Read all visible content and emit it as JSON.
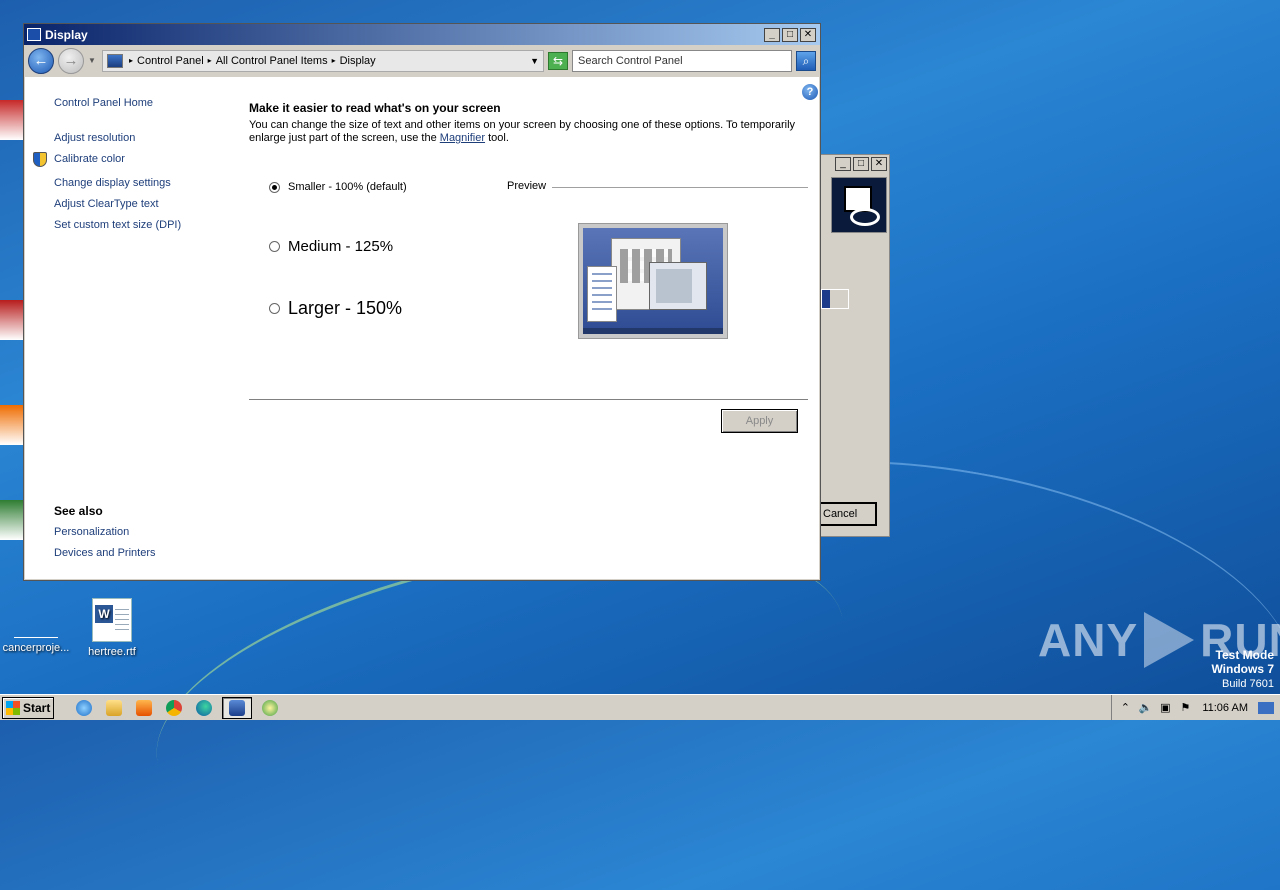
{
  "desktop": {
    "icons": [
      {
        "label": "cancerproje..."
      },
      {
        "label": "hertree.rtf"
      }
    ],
    "watermark": {
      "brand_left": "ANY",
      "brand_right": "RUN"
    },
    "test_mode": {
      "line1": "Test Mode",
      "line2": "Windows 7",
      "line3": "Build 7601"
    }
  },
  "back_window": {
    "cancel_label": "Cancel"
  },
  "window": {
    "title": "Display",
    "breadcrumb": [
      "Control Panel",
      "All Control Panel Items",
      "Display"
    ],
    "search_placeholder": "Search Control Panel",
    "left_links": {
      "home": "Control Panel Home",
      "adjust_resolution": "Adjust resolution",
      "calibrate_color": "Calibrate color",
      "change_display": "Change display settings",
      "cleartype": "Adjust ClearType text",
      "custom_dpi": "Set custom text size (DPI)"
    },
    "see_also": {
      "heading": "See also",
      "personalization": "Personalization",
      "devices": "Devices and Printers"
    },
    "main": {
      "heading": "Make it easier to read what's on your screen",
      "description_part1": "You can change the size of text and other items on your screen by choosing one of these options. To temporarily enlarge just part of the screen, use the ",
      "magnifier_link": "Magnifier",
      "description_part2": " tool.",
      "options": [
        {
          "label": "Smaller - 100% (default)",
          "checked": true
        },
        {
          "label": "Medium - 125%",
          "checked": false
        },
        {
          "label": "Larger - 150%",
          "checked": false
        }
      ],
      "preview_label": "Preview",
      "apply_label": "Apply"
    }
  },
  "taskbar": {
    "start_label": "Start",
    "clock": "11:06 AM"
  }
}
